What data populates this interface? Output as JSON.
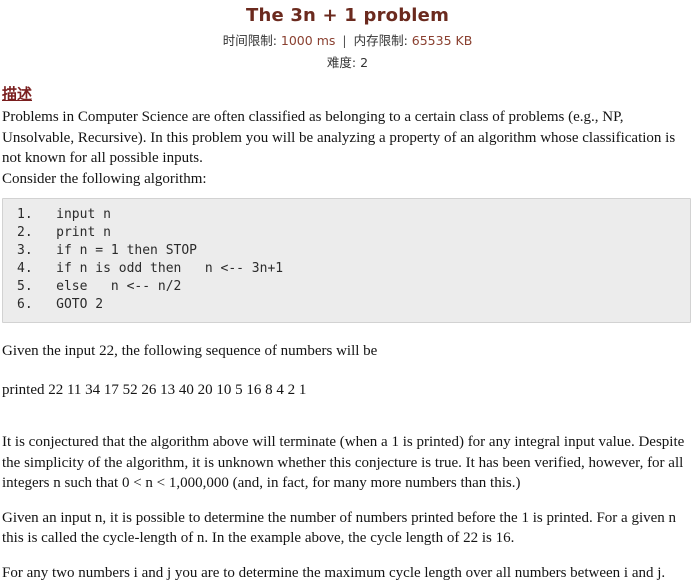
{
  "header": {
    "title": "The 3n + 1 problem",
    "time_limit_label": "时间限制:",
    "time_limit_value": "1000 ms",
    "separator": "|",
    "memory_limit_label": "内存限制:",
    "memory_limit_value": "65535 KB",
    "difficulty_label": "难度:",
    "difficulty_value": "2"
  },
  "description": {
    "heading": "描述",
    "paragraph1": "Problems in Computer Science are often classified as belonging to a certain class of problems (e.g., NP, Unsolvable, Recursive). In this problem you will be analyzing a property of an algorithm whose classification is not known for all possible inputs.",
    "paragraph2": "Consider the following algorithm:",
    "code": [
      "1.   input n",
      "2.   print n",
      "3.   if n = 1 then STOP",
      "4.   if n is odd then   n <-- 3n+1",
      "5.   else   n <-- n/2",
      "6.   GOTO 2"
    ],
    "paragraph3": "Given the input 22, the following sequence of numbers will be",
    "paragraph4": "printed 22 11 34 17 52 26 13 40 20 10 5 16 8 4 2 1",
    "paragraph5": "It is conjectured that the algorithm above will terminate (when a 1 is printed) for any integral input value. Despite the simplicity of the algorithm, it is unknown whether this conjecture is true. It has been verified, however, for all integers n such that 0 < n < 1,000,000 (and, in fact, for many more numbers than this.)",
    "paragraph6": "Given an input n, it is possible to determine the number of numbers printed before the 1 is printed. For a given n this is called the cycle-length of n. In the example above, the cycle length of 22 is 16.",
    "paragraph7": "For any two numbers i and j you are to determine the maximum cycle length over all numbers between i and j."
  },
  "colors": {
    "title": "#6b2a1e",
    "heading": "#7a1f1f",
    "meta_value": "#8a4030",
    "code_bg": "#ececec",
    "code_border": "#d2d2d2"
  }
}
